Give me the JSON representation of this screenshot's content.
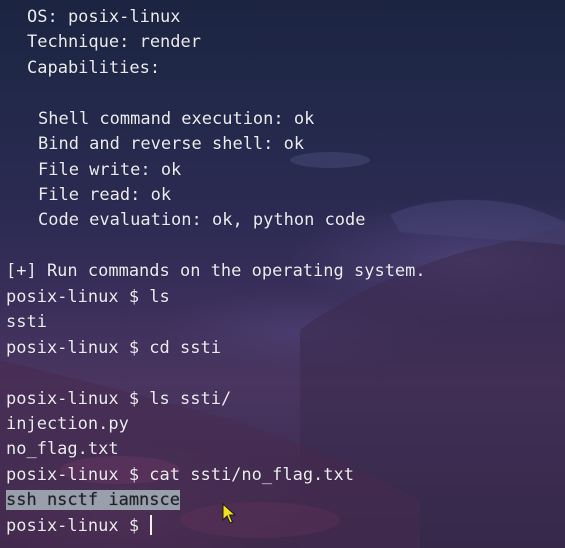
{
  "terminal": {
    "info": {
      "os": "OS: posix-linux",
      "technique": "Technique: render",
      "capabilities": "Capabilities:"
    },
    "capabilities": [
      "Shell command execution: ok",
      "Bind and reverse shell: ok",
      "File write: ok",
      "File read: ok",
      "Code evaluation: ok, python code"
    ],
    "run_notice": "[+] Run commands on the operating system.",
    "session": [
      {
        "prompt": "posix-linux $ ",
        "command": "ls"
      },
      {
        "output": "ssti"
      },
      {
        "prompt": "posix-linux $ ",
        "command": "cd ssti"
      },
      {
        "prompt": "posix-linux $ ",
        "command": "ls ssti/"
      },
      {
        "output": "injection.py"
      },
      {
        "output": "no_flag.txt"
      },
      {
        "prompt": "posix-linux $ ",
        "command": "cat ssti/no_flag.txt"
      },
      {
        "output": "ssh nsctf iamnsce"
      }
    ],
    "current_prompt": "posix-linux $ "
  },
  "colors": {
    "text": "#ececf0",
    "selection": "#9aa0ab",
    "background": "#2b2a52"
  },
  "icons": {
    "pointer": "mouse-pointer-icon",
    "cursor": "text-cursor"
  }
}
